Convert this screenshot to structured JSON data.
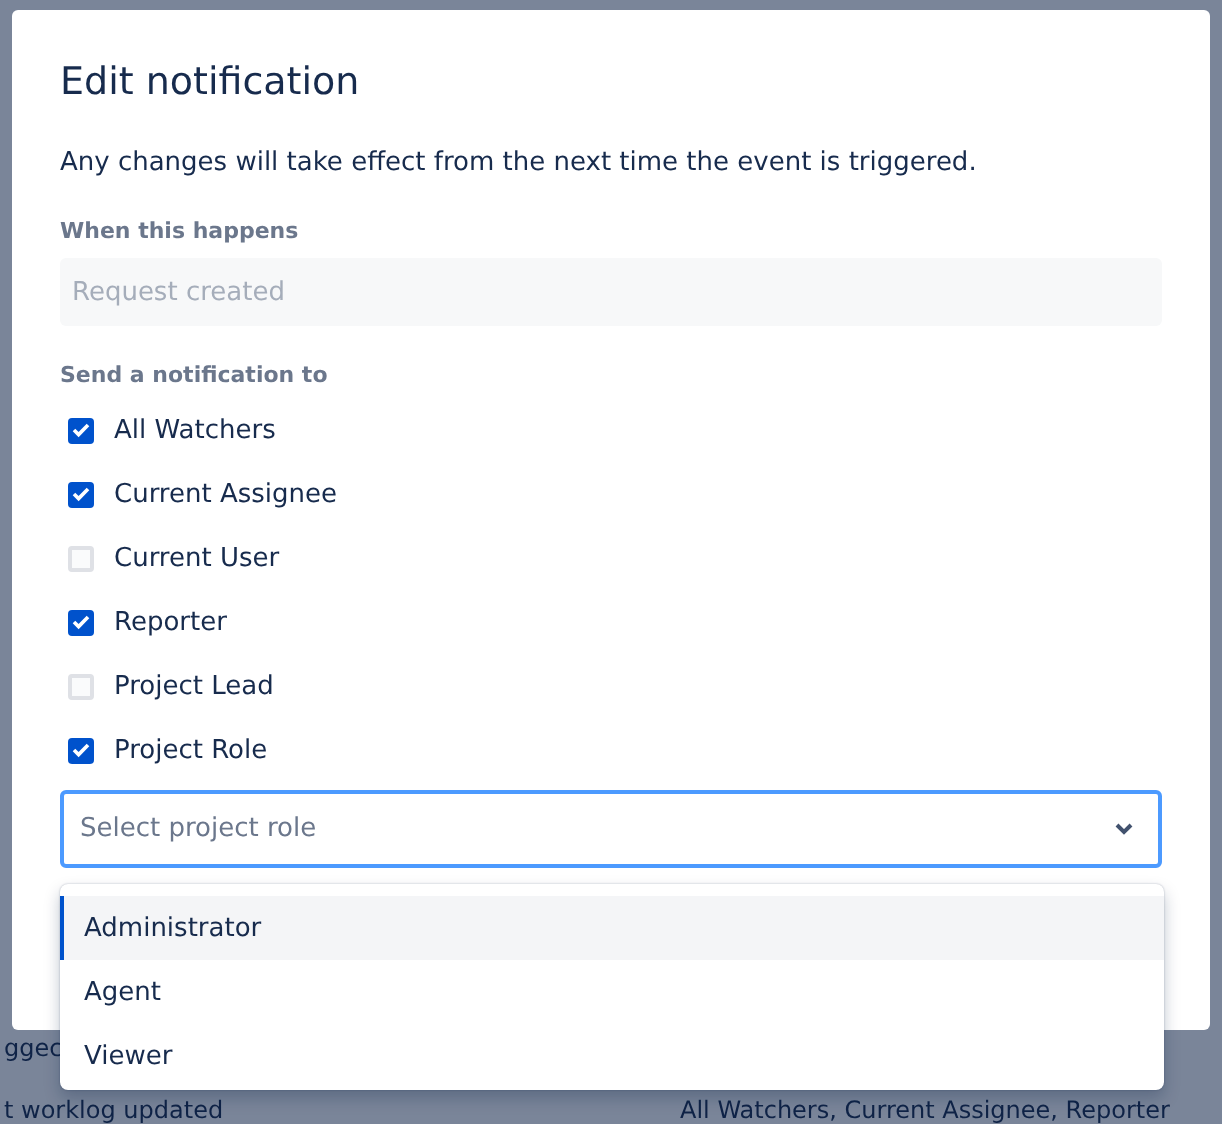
{
  "background_rows": [
    {
      "cells": [
        "ggec"
      ]
    },
    {
      "cells": [
        "t worklog updated",
        "All Watchers, Current Assignee, Reporter"
      ]
    }
  ],
  "dialog": {
    "title": "Edit notification",
    "description": "Any changes will take effect from the next time the event is triggered.",
    "event_label": "When this happens",
    "event_field": {
      "value": "Request created",
      "disabled": true
    },
    "recipients_label": "Send a notification to",
    "recipients": [
      {
        "label": "All Watchers",
        "checked": true
      },
      {
        "label": "Current Assignee",
        "checked": true
      },
      {
        "label": "Current User",
        "checked": false
      },
      {
        "label": "Reporter",
        "checked": true
      },
      {
        "label": "Project Lead",
        "checked": false
      },
      {
        "label": "Project Role",
        "checked": true
      }
    ],
    "role_select": {
      "placeholder": "Select project role",
      "expanded": true,
      "options": [
        {
          "label": "Administrator",
          "selected": true
        },
        {
          "label": "Agent",
          "selected": false
        },
        {
          "label": "Viewer",
          "selected": false
        }
      ]
    }
  }
}
